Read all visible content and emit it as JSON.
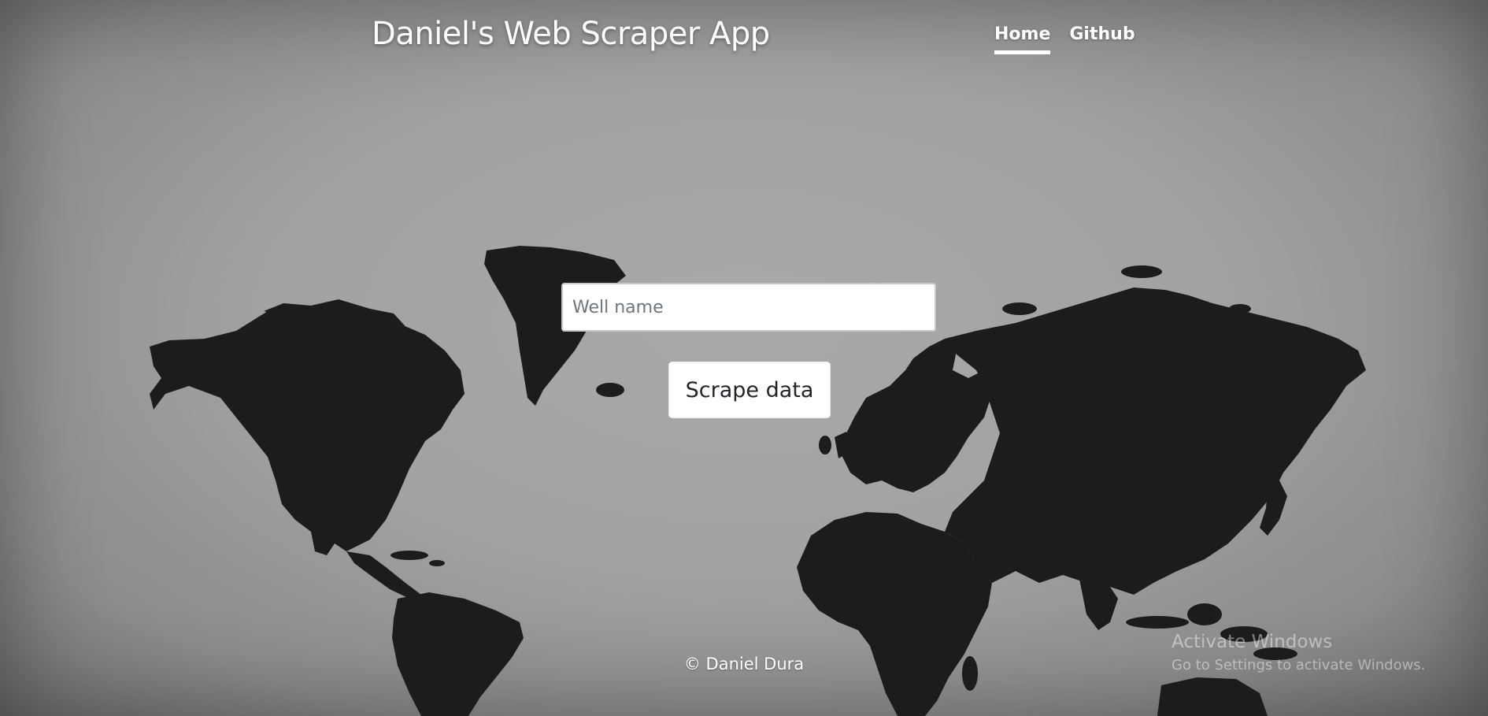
{
  "header": {
    "title": "Daniel's Web Scraper App",
    "nav": [
      {
        "label": "Home",
        "active": true
      },
      {
        "label": "Github",
        "active": false
      }
    ]
  },
  "form": {
    "well_input": {
      "placeholder": "Well name",
      "value": ""
    },
    "scrape_button_label": "Scrape data"
  },
  "footer": {
    "copyright": "© Daniel Dura"
  },
  "os_watermark": {
    "title": "Activate Windows",
    "subtitle": "Go to Settings to activate Windows."
  },
  "background": {
    "image": "world-map-silhouette",
    "colors": {
      "backdrop": "#a2a2a2",
      "land": "#1c1c1c"
    }
  }
}
